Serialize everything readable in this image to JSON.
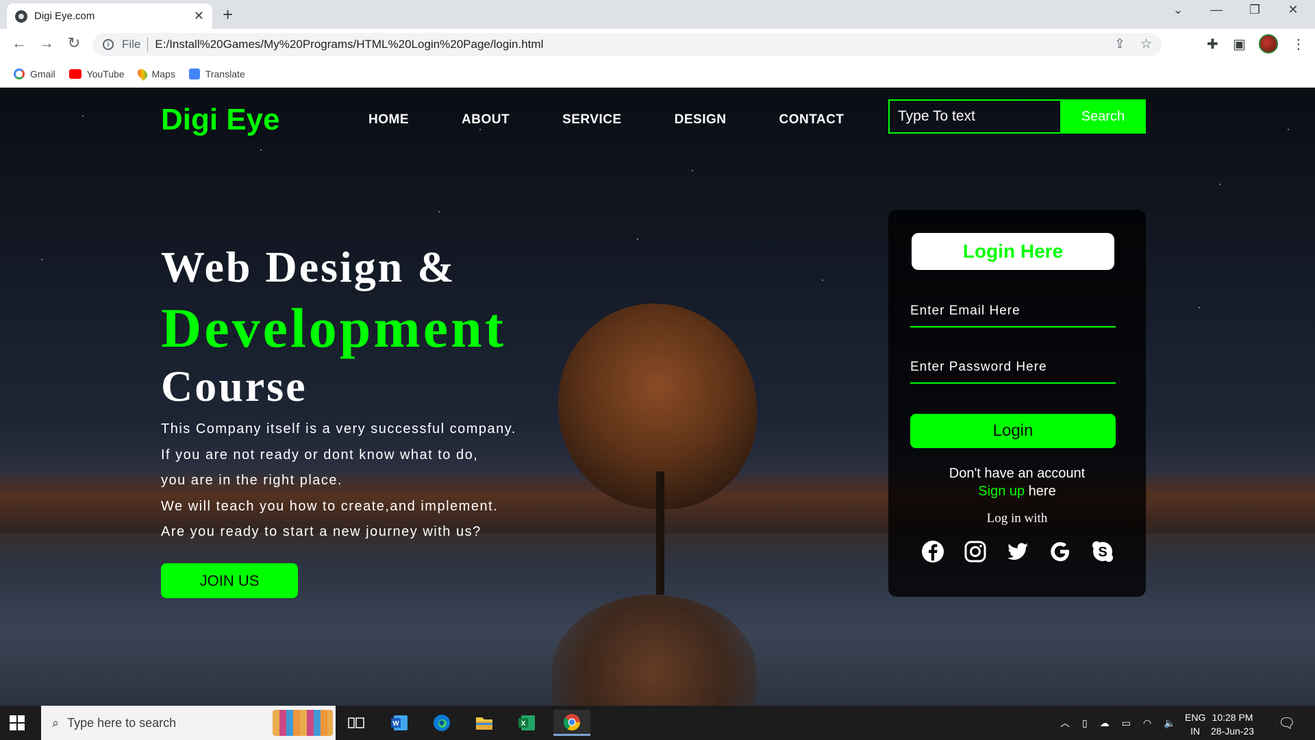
{
  "browser": {
    "tab_title": "Digi Eye.com",
    "omnibox_file_label": "File",
    "url": "E:/Install%20Games/My%20Programs/HTML%20Login%20Page/login.html",
    "bookmarks": [
      {
        "label": "Gmail",
        "icon": "google-icon"
      },
      {
        "label": "YouTube",
        "icon": "youtube-icon"
      },
      {
        "label": "Maps",
        "icon": "maps-icon"
      },
      {
        "label": "Translate",
        "icon": "translate-icon"
      }
    ]
  },
  "site": {
    "brand": "Digi Eye",
    "nav": [
      "HOME",
      "ABOUT",
      "SERVICE",
      "DESIGN",
      "CONTACT"
    ],
    "search_placeholder": "Type To text",
    "search_button": "Search",
    "hero": {
      "line1": "Web Design &",
      "line2": "Development",
      "line3": "Course",
      "paragraph": [
        "This Company itself is a very successful company.",
        "If you are not ready or dont know what to do,",
        "you are in the right place.",
        "We will teach you how to create,and implement.",
        "Are you ready to start a new journey with us?"
      ],
      "join_button": "JOIN US"
    },
    "login": {
      "title": "Login Here",
      "email_placeholder": "Enter Email Here",
      "password_placeholder": "Enter Password Here",
      "login_button": "Login",
      "no_account": "Don't have an account",
      "signup_link": "Sign up",
      "signup_suffix": " here",
      "login_with": "Log in with",
      "socials": [
        "facebook-icon",
        "instagram-icon",
        "twitter-icon",
        "google-icon",
        "skype-icon"
      ]
    }
  },
  "taskbar": {
    "search_placeholder": "Type here to search",
    "lang_line1": "ENG",
    "lang_line2": "IN",
    "time": "10:28 PM",
    "date": "28-Jun-23"
  },
  "colors": {
    "accent": "#00ff00",
    "card_bg": "#000000",
    "text": "#ffffff"
  }
}
